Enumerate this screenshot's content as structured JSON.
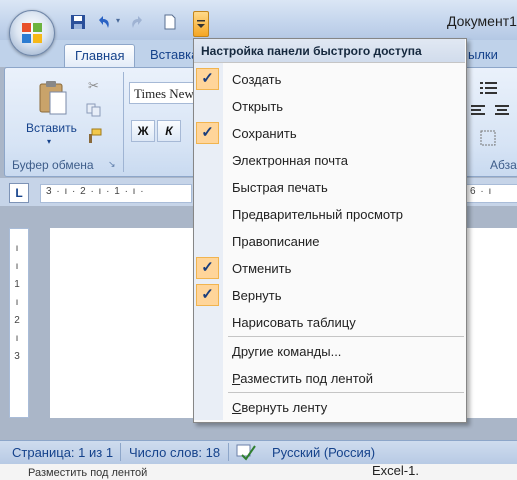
{
  "window": {
    "title": "Документ1"
  },
  "tabs": [
    {
      "label": "Главная",
      "active": true
    },
    {
      "label": "Вставка",
      "active": false
    },
    {
      "label": "ылки",
      "active": false
    }
  ],
  "ribbon": {
    "paste_label": "Вставить",
    "clipboard_group": "Буфер обмена",
    "font_name": "Times New",
    "bold": "Ж",
    "italic": "К",
    "paragraph_group": "Абза"
  },
  "ruler": {
    "corner": "L",
    "left_text": "3 · ı · 2 · ı · 1 · ı ·",
    "right_text": "6 · ı"
  },
  "vruler_text": [
    "ı",
    "ı",
    "1",
    "ı",
    "2",
    "ı",
    "3"
  ],
  "qat_menu": {
    "title": "Настройка панели быстрого доступа",
    "items": [
      {
        "label": "Создать",
        "checked": true
      },
      {
        "label": "Открыть",
        "checked": false
      },
      {
        "label": "Сохранить",
        "checked": true
      },
      {
        "label": "Электронная почта",
        "checked": false
      },
      {
        "label": "Быстрая печать",
        "checked": false
      },
      {
        "label": "Предварительный просмотр",
        "checked": false
      },
      {
        "label": "Правописание",
        "checked": false
      },
      {
        "label": "Отменить",
        "checked": true
      },
      {
        "label": "Вернуть",
        "checked": true
      },
      {
        "label": "Нарисовать таблицу",
        "checked": false
      }
    ],
    "more_commands": {
      "mnemonic": "Д",
      "rest": "ругие команды..."
    },
    "place_below": {
      "mnemonic": "Р",
      "rest": "азместить под лентой"
    },
    "minimize": {
      "mnemonic": "С",
      "rest": "вернуть ленту"
    }
  },
  "status": {
    "page": "Страница: 1 из 1",
    "words": "Число слов: 18",
    "language": "Русский (Россия)"
  },
  "behind": {
    "left": "Разместить под лентой",
    "right": "Excel-1."
  },
  "colors": {
    "accent": "#15428b",
    "check_bg": "#ffd59a",
    "ribbon_bg": "#d7e4f5"
  }
}
